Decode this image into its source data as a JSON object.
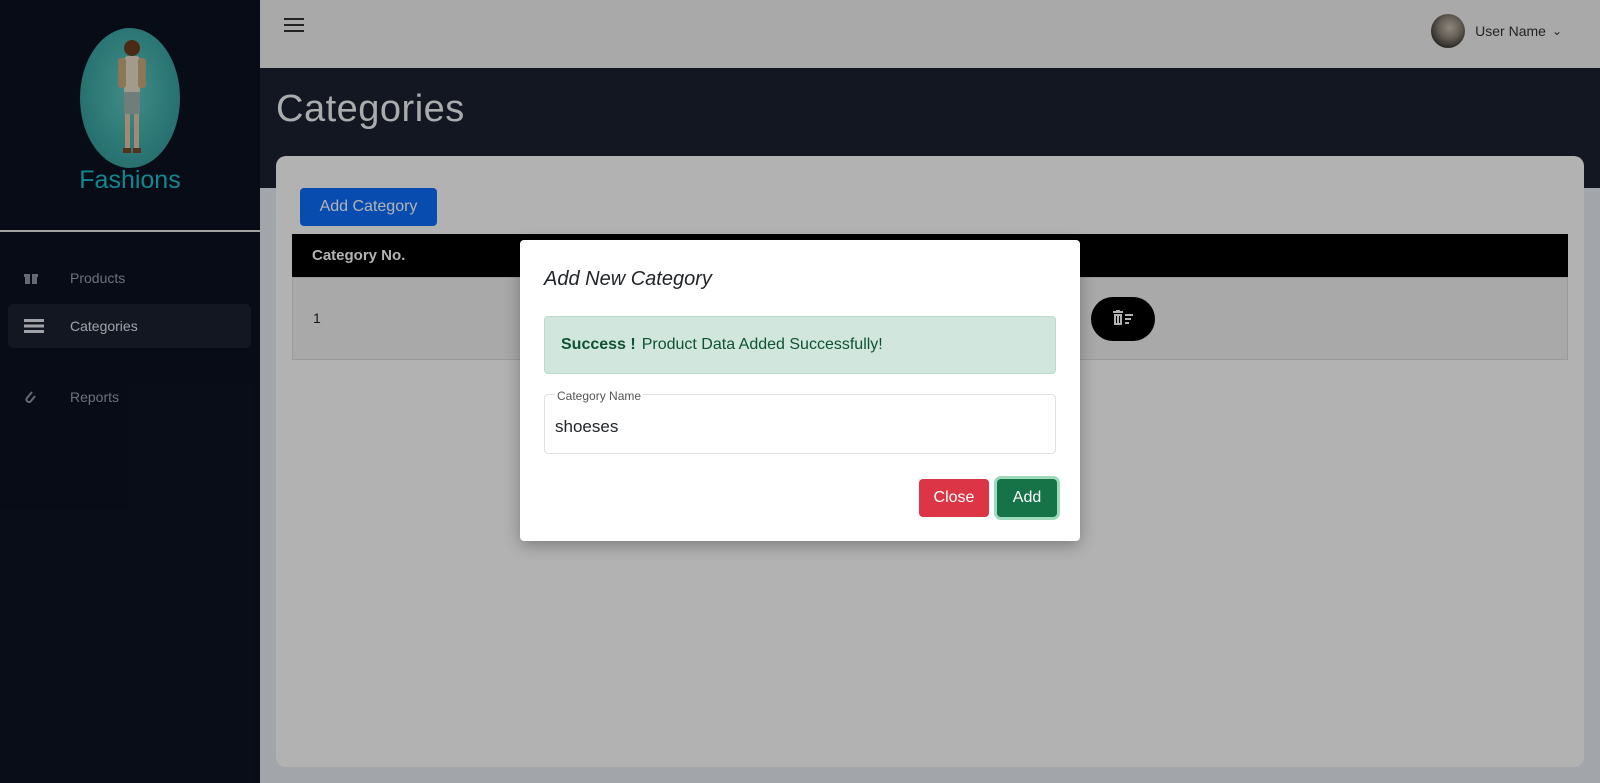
{
  "brand": {
    "name": "Fashions"
  },
  "sidebar": {
    "items": [
      {
        "label": "Products",
        "icon": "gift-icon"
      },
      {
        "label": "Categories",
        "icon": "list-icon",
        "active": true
      },
      {
        "label": "Reports",
        "icon": "paperclip-icon"
      }
    ]
  },
  "topbar": {
    "user_name": "User Name"
  },
  "page": {
    "title": "Categories"
  },
  "toolbar": {
    "add_category_label": "Add Category"
  },
  "table": {
    "headers": [
      "Category No."
    ],
    "rows": [
      {
        "no": "1"
      }
    ]
  },
  "modal": {
    "title": "Add New Category",
    "alert_strong": "Success !",
    "alert_text": "Product Data Added Successfully!",
    "field_label": "Category Name",
    "field_value": "shoeses",
    "close_label": "Close",
    "add_label": "Add"
  },
  "colors": {
    "sidebar_bg": "#0c1221",
    "brand_text": "#19c3cf",
    "primary": "#0d6efd",
    "danger": "#dc3545",
    "success": "#157347",
    "alert_bg": "#d1e7dd"
  }
}
